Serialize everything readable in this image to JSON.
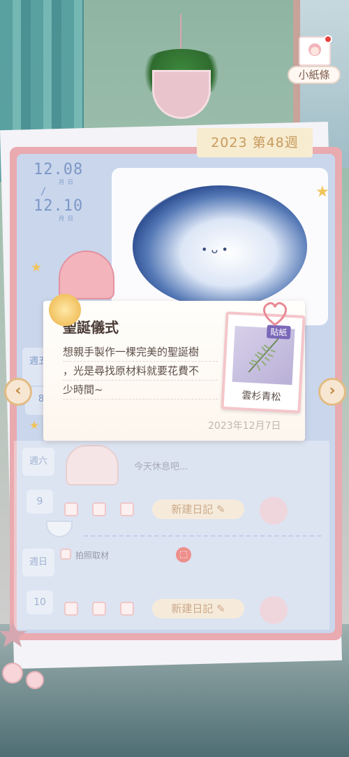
{
  "note_button": {
    "label": "小紙條"
  },
  "week_tag": "2023 第48週",
  "date_range": {
    "start": "12.08",
    "start_sub": "月    日",
    "end": "12.10",
    "end_sub": "月    日",
    "separator": "/"
  },
  "day_tabs": [
    {
      "label": "週五",
      "num": "8"
    }
  ],
  "rows": [
    {
      "label": "週六",
      "num": "9",
      "text": "今天休息吧...",
      "new_button": "新建日記"
    },
    {
      "label": "週日",
      "num": "10",
      "task": "拍照取材",
      "new_button": "新建日記"
    }
  ],
  "popup": {
    "title": "聖誕儀式",
    "body_lines": [
      "想親手製作一棵完美的聖誕樹",
      "，光是尋找原材料就要花費不",
      "少時間~"
    ],
    "date": "2023年12月7日",
    "sticker_badge": "貼紙",
    "sticker_label": "雲杉青松"
  },
  "nav": {
    "prev": "‹",
    "next": "›"
  },
  "colors": {
    "notebook_border": "#e9aab0",
    "notebook_inner": "#c9d6ec",
    "date_text": "#7d98c6",
    "week_tag_text": "#c89a5d",
    "button_bg": "#f1e0c7"
  },
  "icons": {
    "edit": "edit-icon",
    "gift": "gift-icon",
    "heart": "heart-icon",
    "sun": "sun-icon"
  }
}
